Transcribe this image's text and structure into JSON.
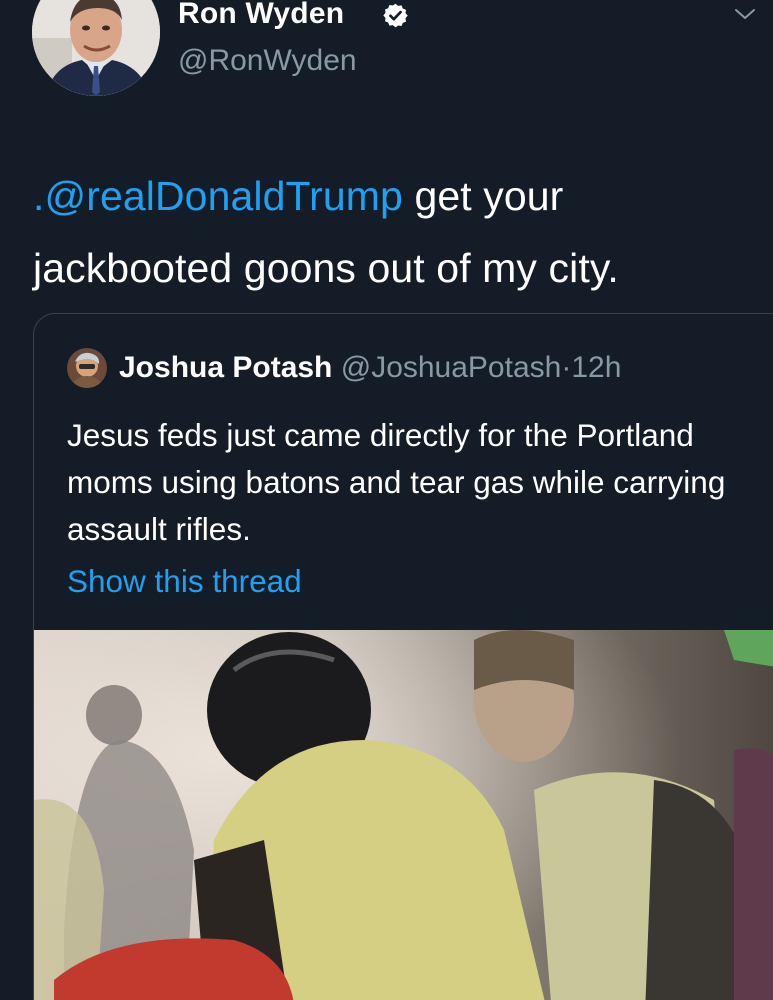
{
  "author": {
    "display_name": "Ron Wyden",
    "handle": "@RonWyden",
    "verified": true
  },
  "tweet": {
    "mention": ".@realDonaldTrump",
    "text": " get your jackbooted goons out of my city."
  },
  "quoted_tweet": {
    "display_name": "Joshua Potash",
    "handle": "@JoshuaPotash",
    "separator": "·",
    "timestamp": "12h",
    "text": "Jesus feds just came directly for the Portland moms using batons and tear gas while carrying assault rifles.",
    "thread_link": "Show this thread"
  },
  "icons": {
    "verified": "verified-badge-icon",
    "menu": "chevron-down-icon"
  },
  "colors": {
    "background": "#141c27",
    "text": "#ffffff",
    "secondary": "#8899a6",
    "link": "#1da1f2",
    "border": "#38444d"
  }
}
